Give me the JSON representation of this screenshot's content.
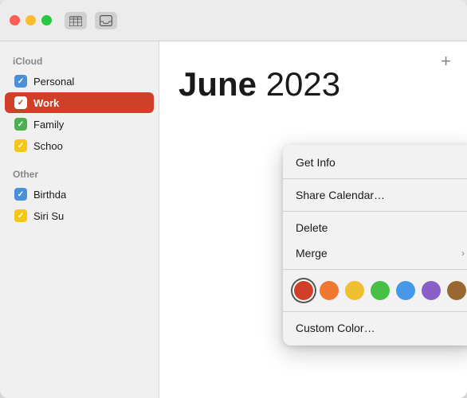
{
  "titlebar": {
    "traffic_lights": [
      "close",
      "minimize",
      "maximize"
    ],
    "icons": [
      "calendar-grid-icon",
      "inbox-icon"
    ]
  },
  "sidebar": {
    "sections": [
      {
        "label": "iCloud",
        "items": [
          {
            "id": "personal",
            "label": "Personal",
            "color": "blue",
            "checked": true,
            "selected": false
          },
          {
            "id": "work",
            "label": "Work",
            "color": "red",
            "checked": true,
            "selected": true
          },
          {
            "id": "family",
            "label": "Family",
            "color": "green",
            "checked": true,
            "selected": false
          },
          {
            "id": "school",
            "label": "Schoo",
            "color": "yellow",
            "checked": true,
            "selected": false
          }
        ]
      },
      {
        "label": "Other",
        "items": [
          {
            "id": "birthdays",
            "label": "Birthda",
            "color": "blue",
            "checked": true,
            "selected": false
          },
          {
            "id": "siri",
            "label": "Siri Su",
            "color": "yellow",
            "checked": true,
            "selected": false
          }
        ]
      }
    ]
  },
  "main": {
    "add_button_label": "+",
    "month": "June",
    "year": "2023"
  },
  "context_menu": {
    "items": [
      {
        "id": "get-info",
        "label": "Get Info",
        "has_submenu": false
      },
      {
        "id": "share-calendar",
        "label": "Share Calendar…",
        "has_submenu": false
      },
      {
        "id": "delete",
        "label": "Delete",
        "has_submenu": false
      },
      {
        "id": "merge",
        "label": "Merge",
        "has_submenu": true
      }
    ],
    "colors": [
      {
        "id": "red",
        "label": "Red",
        "selected": true
      },
      {
        "id": "orange",
        "label": "Orange",
        "selected": false
      },
      {
        "id": "yellow",
        "label": "Yellow",
        "selected": false
      },
      {
        "id": "green",
        "label": "Green",
        "selected": false
      },
      {
        "id": "blue",
        "label": "Blue",
        "selected": false
      },
      {
        "id": "purple",
        "label": "Purple",
        "selected": false
      },
      {
        "id": "brown",
        "label": "Brown",
        "selected": false
      }
    ],
    "custom_color_label": "Custom Color…"
  }
}
